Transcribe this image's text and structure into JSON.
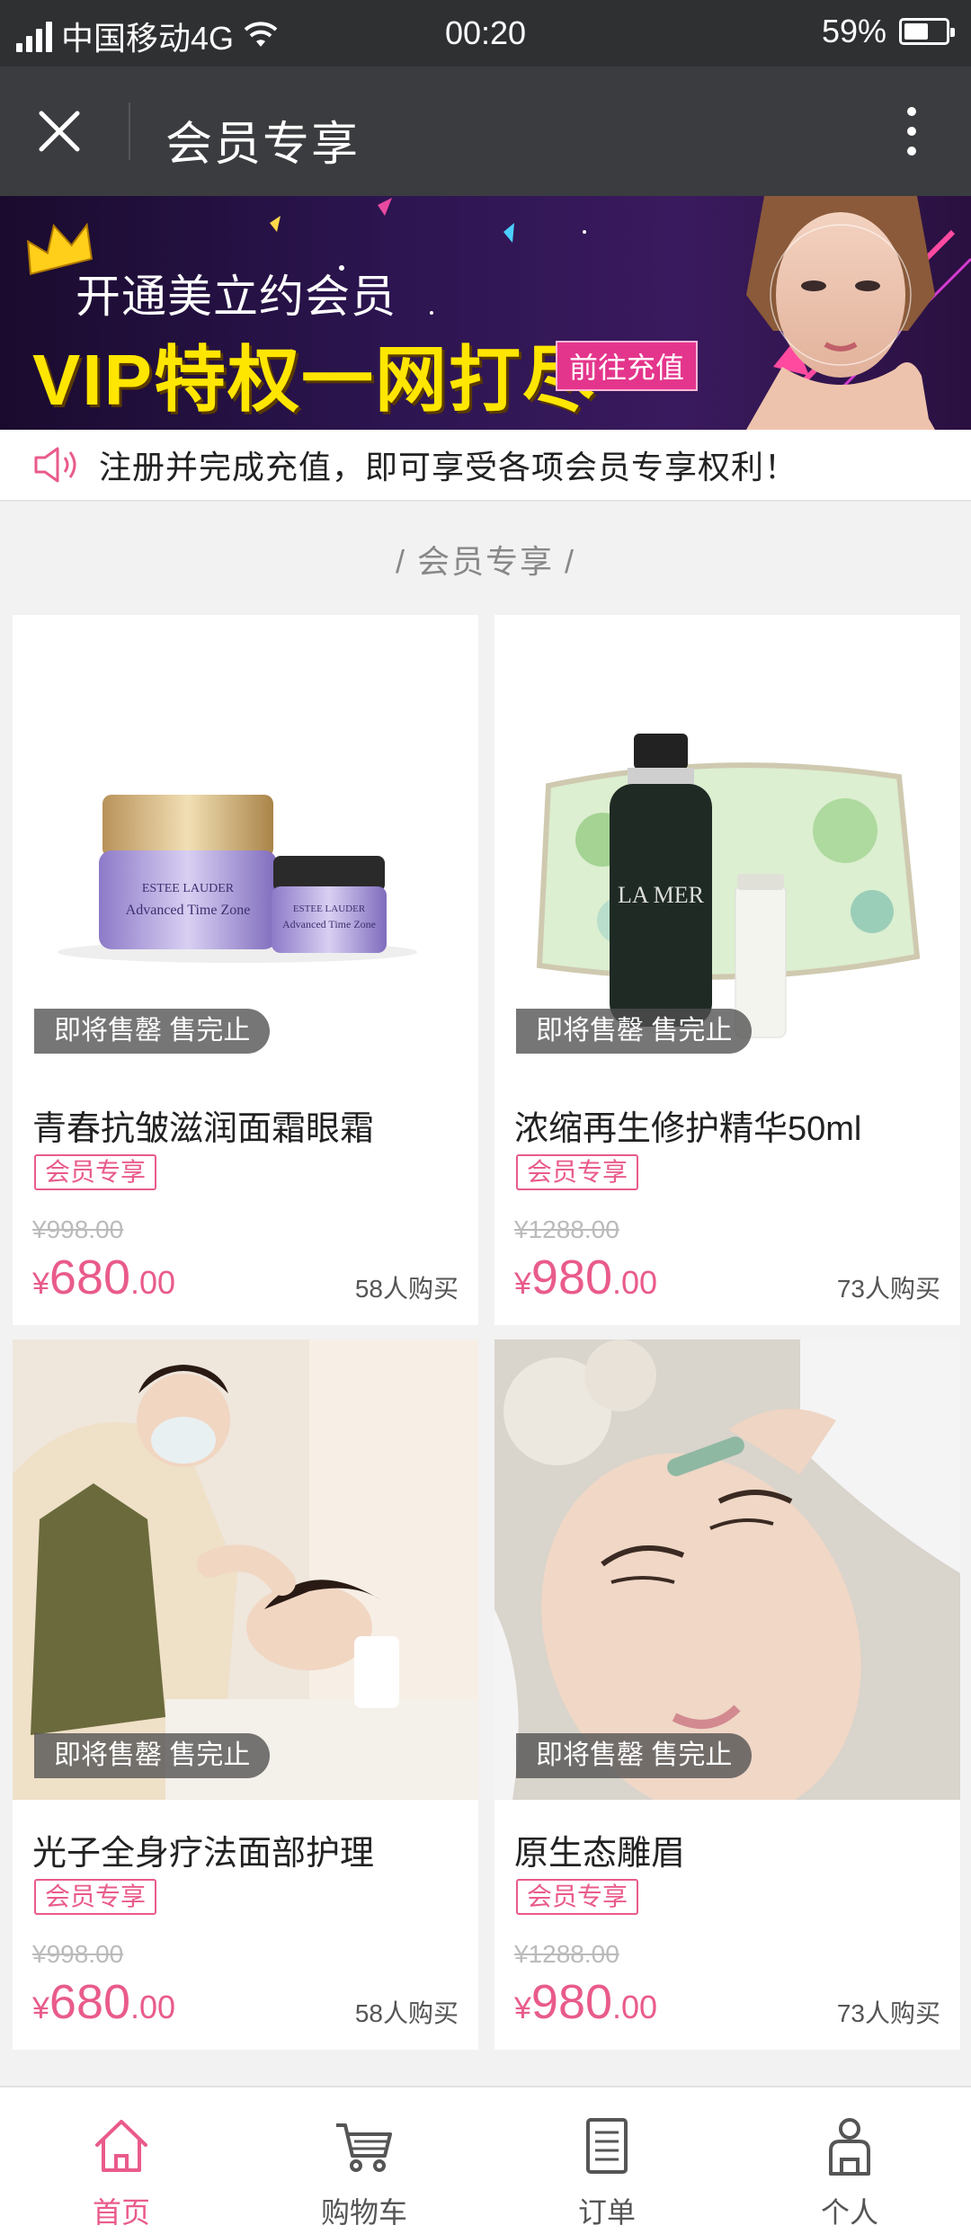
{
  "status_bar": {
    "carrier": "中国移动4G",
    "time": "00:20",
    "battery": "59%",
    "battery_level": 0.59
  },
  "title_bar": {
    "title": "会员专享"
  },
  "banner": {
    "line1": "开通美立约会员",
    "line2": "VIP特权一网打尽",
    "button": "前往充值"
  },
  "notice": {
    "text": "注册并完成充值，即可享受各项会员专享权利！"
  },
  "section": {
    "title": "/ 会员专享 /"
  },
  "products": [
    {
      "name": "青春抗皱滋润面霜眼霜",
      "badge": "会员专享",
      "old_price": "¥998.00",
      "currency": "¥",
      "price_int": "680",
      "price_dec": ".00",
      "sold": "58人购买",
      "tag": "即将售罄 售完止",
      "image": "estee-lauder-cream"
    },
    {
      "name": "浓缩再生修护精华50ml",
      "badge": "会员专享",
      "old_price": "¥1288.00",
      "currency": "¥",
      "price_int": "980",
      "price_dec": ".00",
      "sold": "73人购买",
      "tag": "即将售罄 售完止",
      "image": "la-mer-serum"
    },
    {
      "name": "光子全身疗法面部护理",
      "badge": "会员专享",
      "old_price": "¥998.00",
      "currency": "¥",
      "price_int": "680",
      "price_dec": ".00",
      "sold": "58人购买",
      "tag": "即将售罄 售完止",
      "image": "facial-massage"
    },
    {
      "name": "原生态雕眉",
      "badge": "会员专享",
      "old_price": "¥1288.00",
      "currency": "¥",
      "price_int": "980",
      "price_dec": ".00",
      "sold": "73人购买",
      "tag": "即将售罄 售完止",
      "image": "eyebrow-treatment"
    }
  ],
  "tabs": [
    {
      "label": "首页",
      "icon": "home-icon",
      "active": true
    },
    {
      "label": "购物车",
      "icon": "cart-icon",
      "active": false
    },
    {
      "label": "订单",
      "icon": "order-icon",
      "active": false
    },
    {
      "label": "个人",
      "icon": "person-icon",
      "active": false
    }
  ],
  "colors": {
    "accent": "#e95b8a",
    "header": "#3b3c3f",
    "status_bar": "#2f3032",
    "banner_yellow": "#ffe600"
  }
}
